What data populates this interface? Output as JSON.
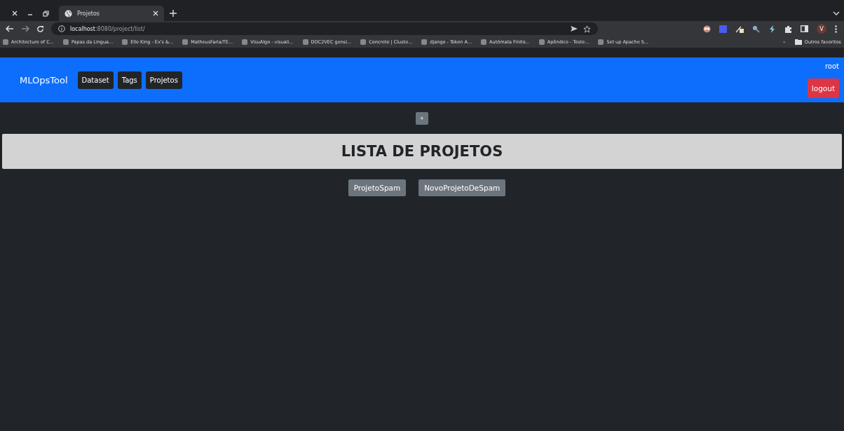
{
  "browser": {
    "tabs": [
      {
        "title": "Projetos",
        "selected": true
      }
    ],
    "url_host": "localhost",
    "url_path": ":8080/project/list/",
    "bookmarks": [
      {
        "label": "Architecture of C..."
      },
      {
        "label": "Papas da Lingua..."
      },
      {
        "label": "Elle King - Ex's &..."
      },
      {
        "label": "MatheusFaria/TE..."
      },
      {
        "label": "VisuAlgo - visuali..."
      },
      {
        "label": "DOC2VEC gensi..."
      },
      {
        "label": "Concrete | Cluste..."
      },
      {
        "label": "django - Token A..."
      },
      {
        "label": "Autómata Finito..."
      },
      {
        "label": "Apêndice - Teste..."
      },
      {
        "label": "Set up Apache S..."
      }
    ],
    "more": "»",
    "other_bookmarks": "Outros favoritos",
    "profile": "V"
  },
  "navbar": {
    "brand": "MLOpsTool",
    "links": [
      "Dataset",
      "Tags",
      "Projetos"
    ],
    "user": "root",
    "logout": "logout"
  },
  "add_button": "+",
  "page_title": "LISTA DE PROJETOS",
  "projects": [
    "ProjetoSpam",
    "NovoProjetoDeSpam"
  ]
}
